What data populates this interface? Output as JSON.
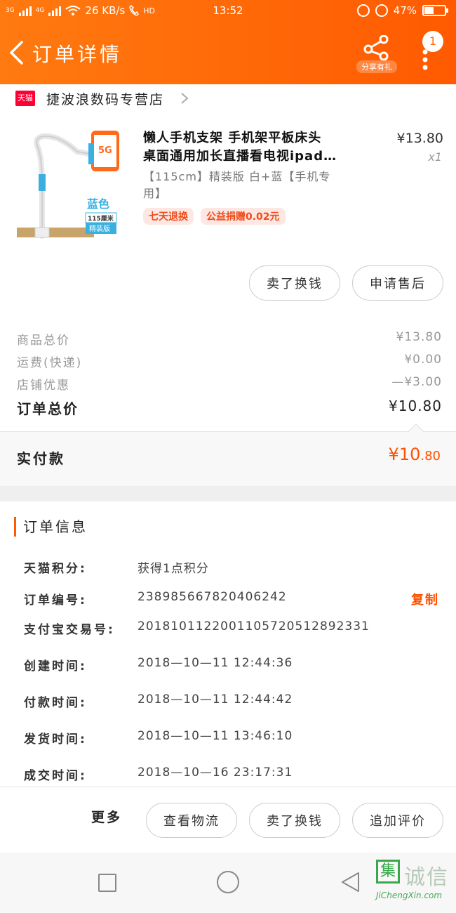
{
  "status_bar": {
    "net_a": "3G",
    "net_b": "4G",
    "speed": "26 KB/s",
    "hd": "HD",
    "time": "13:52",
    "battery": "47%",
    "battery_level": 0.47
  },
  "nav": {
    "title": "订单详情",
    "share_label": "分享有礼",
    "badge": "1"
  },
  "store": {
    "logo": "天猫",
    "name": "捷波浪数码专营店"
  },
  "product": {
    "title_line1": "懒人手机支架 手机架平板床头",
    "title_line2": "桌面通用加长直播看电视ipad…",
    "sku_line1": "【115cm】精装版 白+蓝【手机专",
    "sku_line2": "用】",
    "price": "¥13.80",
    "qty": "x1",
    "image_text": {
      "color": "蓝色",
      "length": "115厘米",
      "edition": "精装版",
      "phone": "5G"
    },
    "tags": [
      "七天退换",
      "公益捐赠0.02元"
    ]
  },
  "actions": {
    "sell": "卖了换钱",
    "after_sale": "申请售后"
  },
  "fees": [
    {
      "label": "商品总价",
      "value": "¥13.80"
    },
    {
      "label": "运费(快递)",
      "value": "¥0.00"
    },
    {
      "label": "店铺优惠",
      "value": "—¥3.00"
    }
  ],
  "order_total": {
    "label": "订单总价",
    "value": "¥10.80"
  },
  "paid": {
    "label": "实付款",
    "value_main": "¥10",
    "value_dec": ".80"
  },
  "order_info": {
    "heading": "订单信息",
    "copy_label": "复制",
    "rows": [
      {
        "label": "天猫积分:",
        "value": "获得1点积分"
      },
      {
        "label": "订单编号:",
        "value": "238985667820406242"
      },
      {
        "label": "支付宝交易号:",
        "value": "2018101122001105720512892331"
      },
      {
        "label": "创建时间:",
        "value": "2018—10—11 12:44:36"
      },
      {
        "label": "付款时间:",
        "value": "2018—10—11 12:44:42"
      },
      {
        "label": "发货时间:",
        "value": "2018—10—11 13:46:10"
      },
      {
        "label": "成交时间:",
        "value": "2018—10—16 23:17:31"
      }
    ]
  },
  "bottom_bar": {
    "more": "更多",
    "logistics": "查看物流",
    "sell": "卖了换钱",
    "review": "追加评价"
  },
  "watermark": {
    "mark": "集",
    "text": "诚信",
    "url": "JiChengXin.com"
  },
  "colors": {
    "accent": "#ff5a00",
    "price_red": "#ff5000",
    "tmall_red": "#ff0036"
  }
}
